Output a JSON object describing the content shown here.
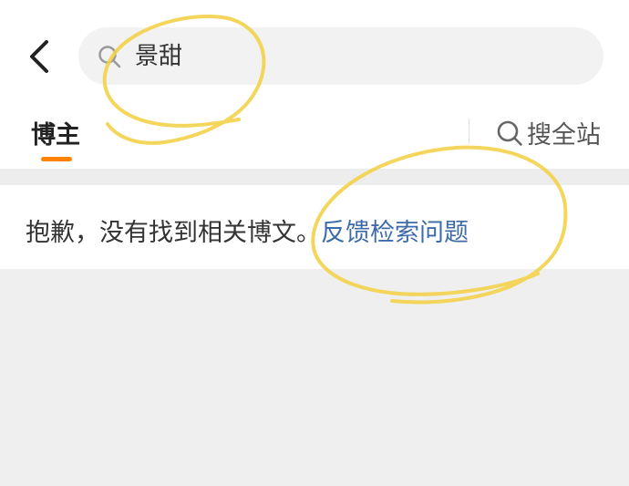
{
  "header": {
    "back_icon": "chevron-left-icon",
    "search": {
      "icon": "search-icon",
      "query": "景甜"
    }
  },
  "tabs": {
    "active_label": "博主",
    "indicator_color": "#ff8200",
    "search_site_icon": "search-icon",
    "search_site_label": "搜全站"
  },
  "result": {
    "message": "抱歉，没有找到相关博文。",
    "feedback_link": "反馈检索问题",
    "link_color": "#3d6ba8"
  },
  "annotation": {
    "color": "#f3d24a"
  }
}
